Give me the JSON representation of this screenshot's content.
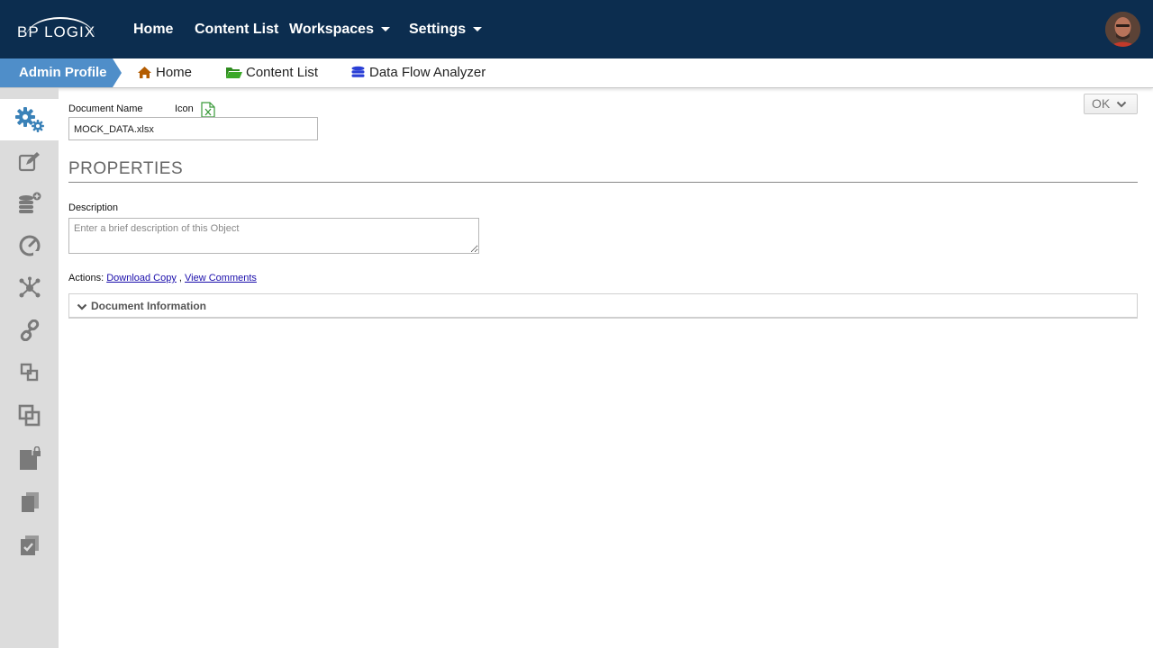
{
  "header": {
    "logo_text": "BP LOGIX",
    "nav": [
      {
        "label": "Home"
      },
      {
        "label": "Content List"
      },
      {
        "label": "Workspaces"
      },
      {
        "label": "Settings"
      }
    ]
  },
  "breadcrumb": {
    "active": "Admin Profile",
    "items": [
      {
        "label": "Home",
        "icon": "home-icon",
        "color": "#b35c00"
      },
      {
        "label": "Content List",
        "icon": "folder-open-icon",
        "color": "#2e8b1e"
      },
      {
        "label": "Data Flow Analyzer",
        "icon": "database-icon",
        "color": "#2a3fd6"
      }
    ]
  },
  "sidebar": {
    "items": [
      {
        "icon": "gears-icon",
        "active": true
      },
      {
        "icon": "edit-icon"
      },
      {
        "icon": "database-add-icon"
      },
      {
        "icon": "dashboard-gauge-icon"
      },
      {
        "icon": "network-icon"
      },
      {
        "icon": "link-icon"
      },
      {
        "icon": "shapes-icon"
      },
      {
        "icon": "copy-boxes-icon"
      },
      {
        "icon": "file-lock-icon"
      },
      {
        "icon": "documents-icon"
      },
      {
        "icon": "checklist-icon"
      }
    ]
  },
  "form": {
    "document_name_label": "Document Name",
    "icon_label": "Icon",
    "document_name_value": "MOCK_DATA.xlsx",
    "ok_label": "OK",
    "properties_title": "PROPERTIES",
    "description_label": "Description",
    "description_placeholder": "Enter a brief description of this Object",
    "actions_label": "Actions:",
    "action_download": "Download Copy",
    "action_separator": " , ",
    "action_comments": "View Comments",
    "doc_info_label": "Document Information"
  },
  "colors": {
    "topbar": "#0c2d4f",
    "breadcrumb_active": "#4f8ec9",
    "sidebar_bg": "#dcdcdc",
    "sidebar_active_icon": "#3b82b8",
    "sidebar_icon": "#7a7a7a"
  }
}
